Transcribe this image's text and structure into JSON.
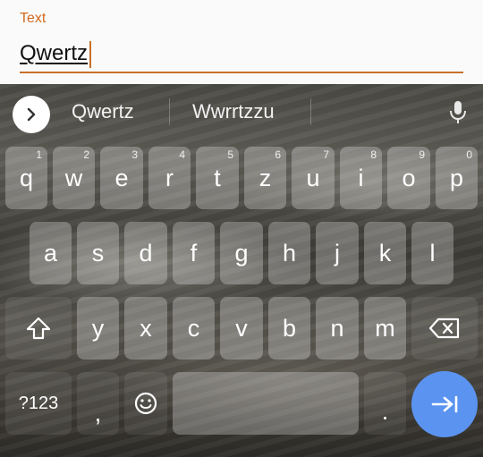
{
  "field": {
    "label": "Text",
    "value": "Qwertz"
  },
  "suggestions": {
    "items": [
      "Qwertz",
      "Wwrrtzzu"
    ],
    "expand_icon": "chevron-right-icon",
    "voice_icon": "microphone-icon"
  },
  "keyboard": {
    "row1": [
      {
        "char": "q",
        "hint": "1"
      },
      {
        "char": "w",
        "hint": "2"
      },
      {
        "char": "e",
        "hint": "3"
      },
      {
        "char": "r",
        "hint": "4"
      },
      {
        "char": "t",
        "hint": "5"
      },
      {
        "char": "z",
        "hint": "6"
      },
      {
        "char": "u",
        "hint": "7"
      },
      {
        "char": "i",
        "hint": "8"
      },
      {
        "char": "o",
        "hint": "9"
      },
      {
        "char": "p",
        "hint": "0"
      }
    ],
    "row2": [
      "a",
      "s",
      "d",
      "f",
      "g",
      "h",
      "j",
      "k",
      "l"
    ],
    "row3": [
      "y",
      "x",
      "c",
      "v",
      "b",
      "n",
      "m"
    ],
    "symbols_label": "?123",
    "comma_label": ",",
    "period_label": ".",
    "shift_icon": "shift-icon",
    "backspace_icon": "backspace-icon",
    "emoji_icon": "emoji-icon",
    "enter_icon": "tab-arrow-icon"
  },
  "colors": {
    "accent": "#d2691e",
    "enter": "#5b93f0"
  }
}
